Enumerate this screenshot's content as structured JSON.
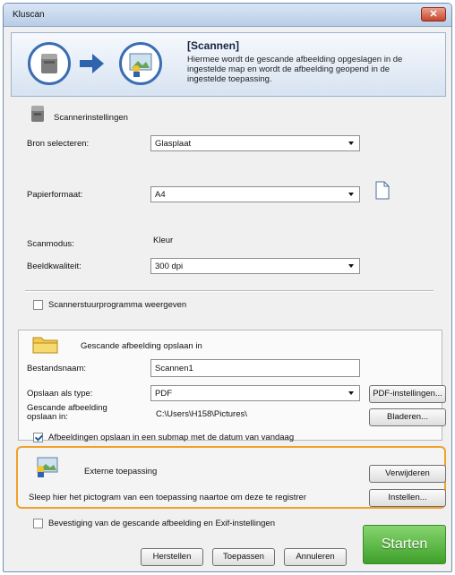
{
  "window": {
    "title": "Kluscan",
    "close": "✕"
  },
  "banner": {
    "title": "[Scannen]",
    "description": "Hiermee wordt de gescande afbeelding opgeslagen in de ingestelde map en wordt de afbeelding geopend in de ingestelde toepassing."
  },
  "scanner": {
    "heading": "Scannerinstellingen",
    "source_label": "Bron selecteren:",
    "source_value": "Glasplaat",
    "paper_label": "Papierformaat:",
    "paper_value": "A4",
    "mode_label": "Scanmodus:",
    "mode_value": "Kleur",
    "quality_label": "Beeldkwaliteit:",
    "quality_value": "300 dpi",
    "driver_checkbox": "Scannerstuurprogramma weergeven"
  },
  "save": {
    "heading": "Gescande afbeelding opslaan in",
    "filename_label": "Bestandsnaam:",
    "filename_value": "Scannen1",
    "type_label": "Opslaan als type:",
    "type_value": "PDF",
    "pdf_settings_button": "PDF-instellingen...",
    "location_label": "Gescande afbeelding opslaan in:",
    "location_value": "C:\\Users\\H158\\Pictures\\",
    "browse_button": "Bladeren...",
    "subfolder_checkbox": "Afbeeldingen opslaan in een submap met de datum van vandaag"
  },
  "external": {
    "heading": "Externe toepassing",
    "hint": "Sleep hier het pictogram van een toepassing naartoe om deze te registrer",
    "remove_button": "Verwijderen",
    "settings_button": "Instellen..."
  },
  "footer": {
    "confirm_checkbox": "Bevestiging van de gescande afbeelding en Exif-instellingen",
    "reset_button": "Herstellen",
    "apply_button": "Toepassen",
    "cancel_button": "Annuleren",
    "start_button": "Starten"
  }
}
